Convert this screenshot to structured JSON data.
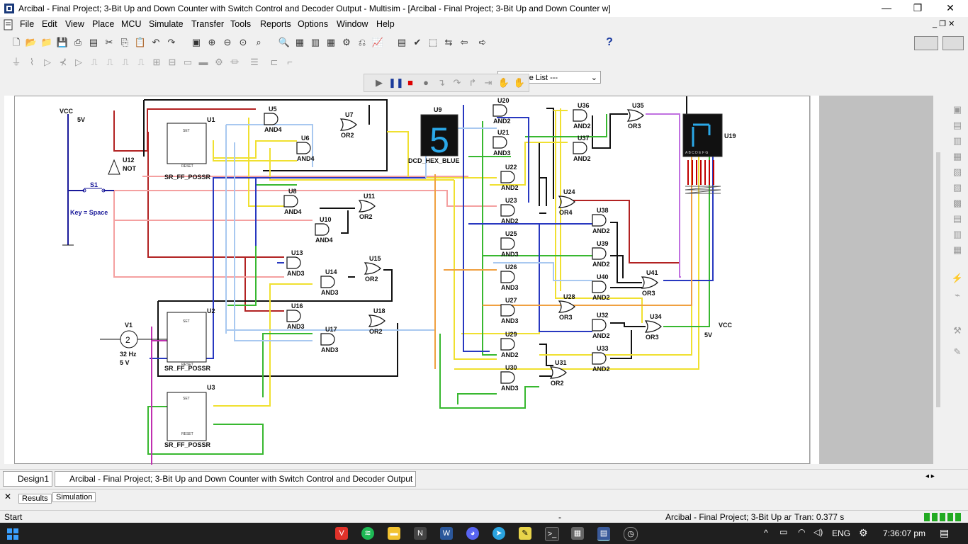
{
  "window": {
    "title": "Arcibal - Final Project;  3-Bit Up and Down Counter with Switch Control and Decoder Output - Multisim - [Arcibal - Final Project;  3-Bit Up and Down Counter w]",
    "minimize": "—",
    "restore": "❐",
    "close": "✕"
  },
  "menu": [
    "File",
    "Edit",
    "View",
    "Place",
    "MCU",
    "Simulate",
    "Transfer",
    "Tools",
    "Reports",
    "Options",
    "Window",
    "Help"
  ],
  "toolbar": {
    "inuse_label": "--- In Use List ---",
    "help": "?"
  },
  "schematic": {
    "vcc_top": "VCC",
    "vcc_top_v": "5V",
    "u12": "U12",
    "u12_type": "NOT",
    "s1": "S1",
    "s1_key": "Key = Space",
    "v1": "V1",
    "v1_freq": "32 Hz",
    "v1_amp": "5 V",
    "ff_type": "SR_FF_POSSR",
    "ff_set": "SET",
    "ff_reset": "RESET",
    "u1": "U1",
    "u2": "U2",
    "u3": "U3",
    "u9": "U9",
    "u9_type": "DCD_HEX_BLUE",
    "u9_digit": "5",
    "u19": "U19",
    "u19_pins": "A B C D E F G",
    "vcc_right": "VCC",
    "vcc_right_v": "5V",
    "gates": [
      {
        "id": "U5",
        "type": "AND4"
      },
      {
        "id": "U6",
        "type": "AND4"
      },
      {
        "id": "U7",
        "type": "OR2"
      },
      {
        "id": "U8",
        "type": "AND4"
      },
      {
        "id": "U10",
        "type": "AND4"
      },
      {
        "id": "U11",
        "type": "OR2"
      },
      {
        "id": "U13",
        "type": "AND3"
      },
      {
        "id": "U14",
        "type": "AND3"
      },
      {
        "id": "U15",
        "type": "OR2"
      },
      {
        "id": "U16",
        "type": "AND3"
      },
      {
        "id": "U17",
        "type": "AND3"
      },
      {
        "id": "U18",
        "type": "OR2"
      },
      {
        "id": "U20",
        "type": "AND2"
      },
      {
        "id": "U21",
        "type": "AND3"
      },
      {
        "id": "U22",
        "type": "AND2"
      },
      {
        "id": "U23",
        "type": "AND2"
      },
      {
        "id": "U25",
        "type": "AND3"
      },
      {
        "id": "U26",
        "type": "AND3"
      },
      {
        "id": "U27",
        "type": "AND3"
      },
      {
        "id": "U29",
        "type": "AND2"
      },
      {
        "id": "U30",
        "type": "AND3"
      },
      {
        "id": "U31",
        "type": "OR2"
      },
      {
        "id": "U24",
        "type": "OR4"
      },
      {
        "id": "U28",
        "type": "OR3"
      },
      {
        "id": "U36",
        "type": "AND2"
      },
      {
        "id": "U37",
        "type": "AND2"
      },
      {
        "id": "U35",
        "type": "OR3"
      },
      {
        "id": "U38",
        "type": "AND2"
      },
      {
        "id": "U39",
        "type": "AND2"
      },
      {
        "id": "U40",
        "type": "AND2"
      },
      {
        "id": "U41",
        "type": "OR3"
      },
      {
        "id": "U32",
        "type": "AND2"
      },
      {
        "id": "U33",
        "type": "AND2"
      },
      {
        "id": "U34",
        "type": "OR3"
      }
    ]
  },
  "tabs": [
    {
      "label": "Design1"
    },
    {
      "label": "Arcibal - Final Project;  3-Bit Up and Down Counter with Switch Control and Decoder Output"
    }
  ],
  "bottom_tabs": [
    "Results",
    "Simulation"
  ],
  "status": {
    "left": "Start",
    "middle": "-",
    "file": "Arcibal - Final Project;  3-Bit Up ar",
    "tran": "Tran: 0.377 s"
  },
  "taskbar": {
    "lang": "ENG",
    "time": "7:36:07 pm"
  },
  "colors": {
    "wire_red": "#b22222",
    "wire_pink": "#f4a0a0",
    "wire_yellow": "#f0e030",
    "wire_green": "#38b830",
    "wire_blue": "#2838c0",
    "wire_lightblue": "#a8c8f0",
    "wire_orange": "#f0a040",
    "wire_purple": "#c070e0",
    "wire_magenta": "#c030b0"
  }
}
